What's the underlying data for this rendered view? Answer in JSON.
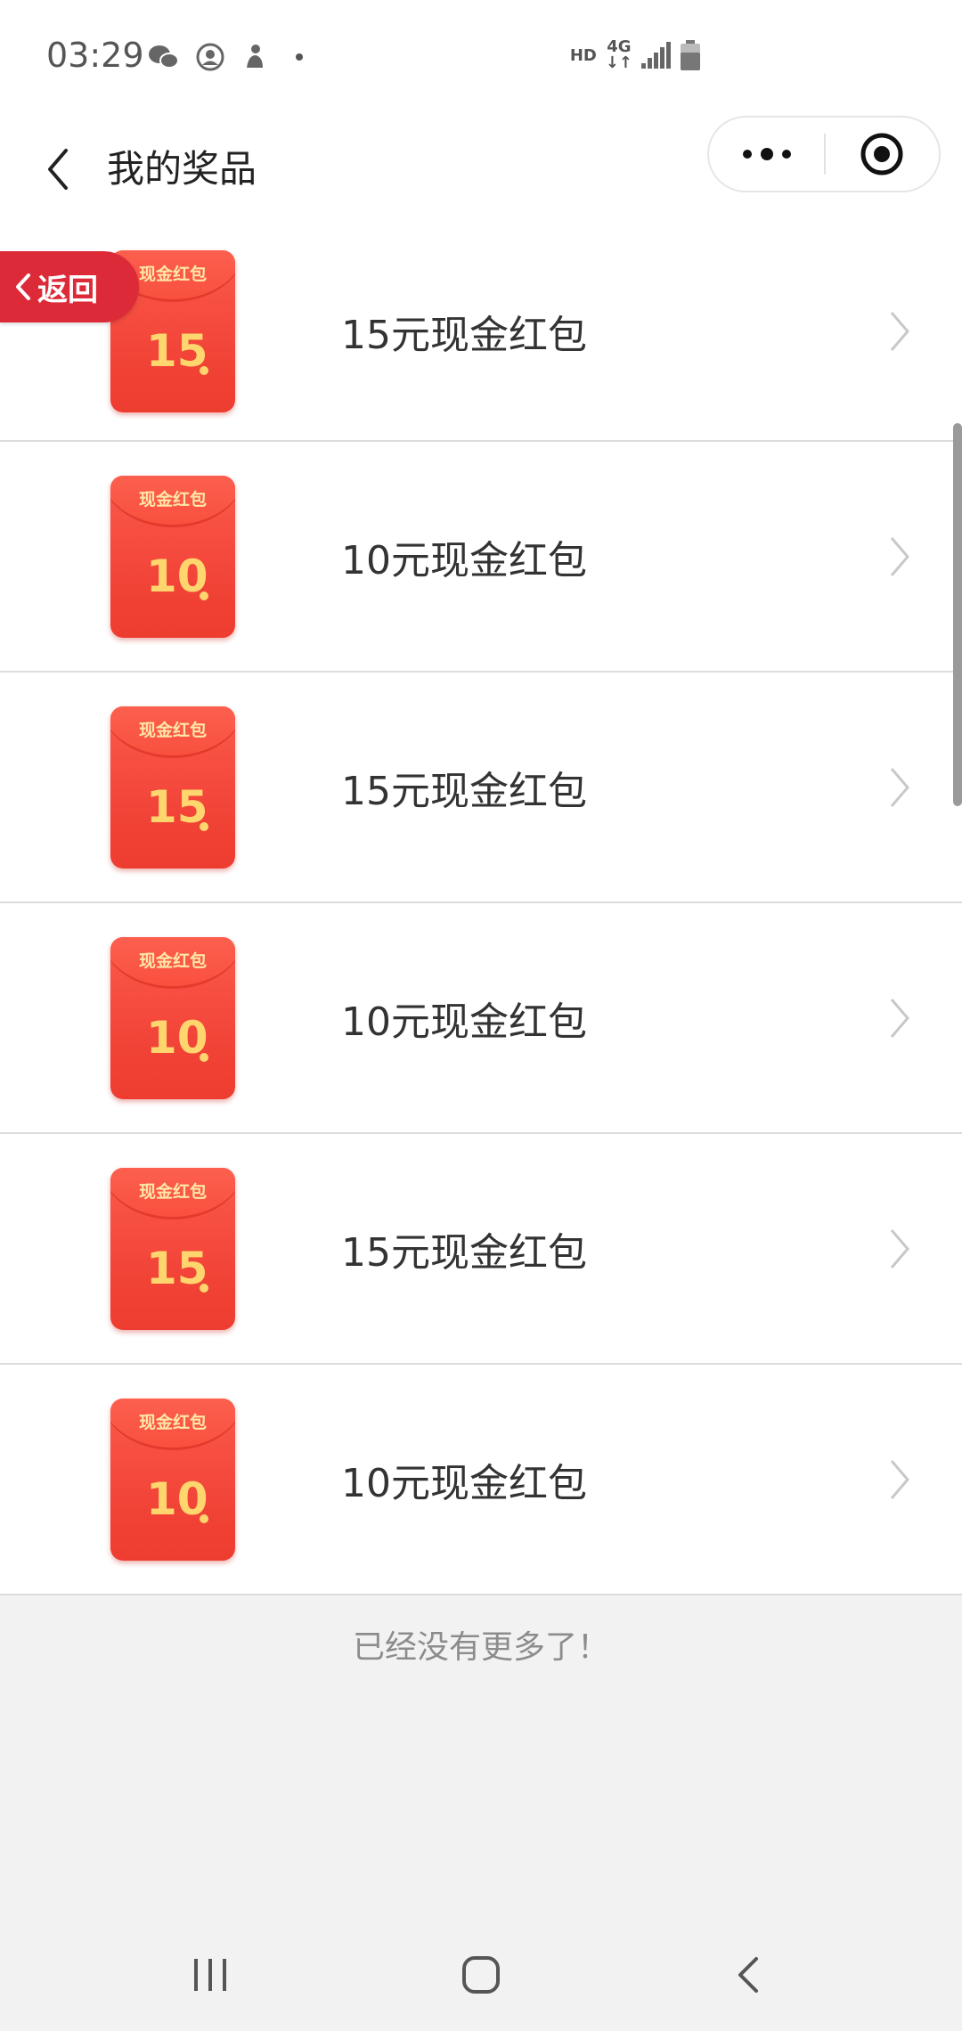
{
  "status_bar": {
    "time": "03:29",
    "left_icons": [
      "wechat-icon",
      "account-icon",
      "person-icon"
    ],
    "hd": "HD",
    "network": "4G"
  },
  "nav": {
    "title": "我的奖品"
  },
  "return_button": {
    "label": "返回"
  },
  "prizes": [
    {
      "title": "15元现金红包",
      "envelope_label": "现金红包",
      "amount": "15"
    },
    {
      "title": "10元现金红包",
      "envelope_label": "现金红包",
      "amount": "10"
    },
    {
      "title": "15元现金红包",
      "envelope_label": "现金红包",
      "amount": "15"
    },
    {
      "title": "10元现金红包",
      "envelope_label": "现金红包",
      "amount": "10"
    },
    {
      "title": "15元现金红包",
      "envelope_label": "现金红包",
      "amount": "15"
    },
    {
      "title": "10元现金红包",
      "envelope_label": "现金红包",
      "amount": "10"
    }
  ],
  "footer": {
    "no_more_text": "已经没有更多了！"
  },
  "colors": {
    "return_bg": "#dd2a38",
    "envelope_red": "#f14236",
    "envelope_gold": "#ffd66e"
  }
}
